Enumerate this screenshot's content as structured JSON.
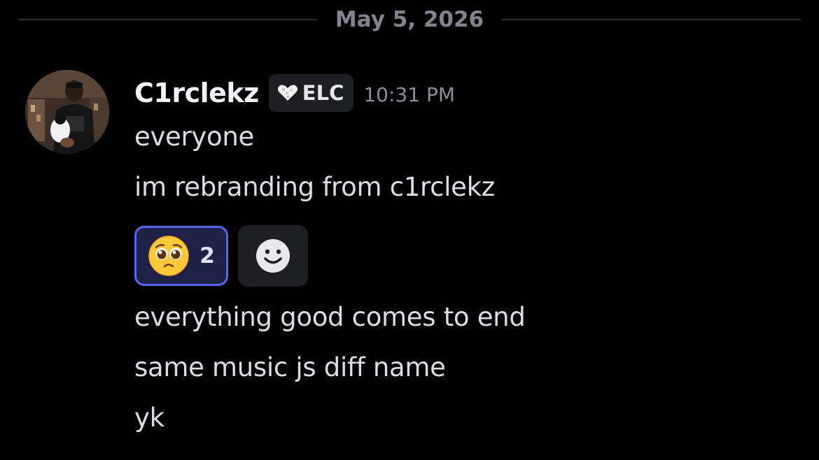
{
  "divider": {
    "date": "May 5, 2026"
  },
  "message": {
    "author": "C1rclekz",
    "tag": {
      "icon": "white-heart-icon",
      "label": "ELC"
    },
    "timestamp": "10:31 PM",
    "lines_before_reactions": [
      "everyone",
      "im rebranding from c1rclekz"
    ],
    "reactions": [
      {
        "emoji": "pleading-face-emoji",
        "count": "2",
        "active": true
      }
    ],
    "add_reaction": {
      "icon": "add-reaction-smile-icon"
    },
    "lines_after_reactions": [
      "everything good comes to end",
      "same music js diff name",
      "yk"
    ]
  },
  "colors": {
    "background": "#000000",
    "accent": "#5865f2",
    "reaction_active_bg": "#1f2246"
  }
}
